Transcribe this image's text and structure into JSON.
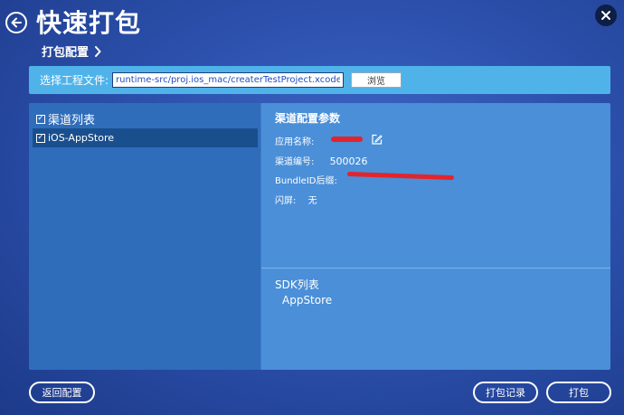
{
  "header": {
    "title": "快速打包",
    "breadcrumb": "打包配置"
  },
  "filebar": {
    "label": "选择工程文件:",
    "path": "runtime-src/proj.ios_mac/createrTestProject.xcodeproj",
    "browse_label": "浏览"
  },
  "channels": {
    "header": "渠道列表",
    "items": [
      {
        "label": "iOS-AppStore",
        "checked": true
      }
    ]
  },
  "config": {
    "title": "渠道配置参数",
    "app_name_label": "应用名称:",
    "channel_id_label": "渠道编号:",
    "channel_id_value": "500026",
    "bundle_suffix_label": "BundleID后缀:",
    "splash_label": "闪屏:",
    "splash_value": "无"
  },
  "sdk": {
    "title": "SDK列表",
    "items": [
      "AppStore"
    ]
  },
  "footer": {
    "back_config_label": "返回配置",
    "history_label": "打包记录",
    "build_label": "打包"
  },
  "colors": {
    "filebar": "#4fb3ea",
    "panel": "#4a8fd8",
    "left_column": "#2f6dbb",
    "selected_item": "#1a4f8e",
    "redaction": "#e3242b"
  }
}
